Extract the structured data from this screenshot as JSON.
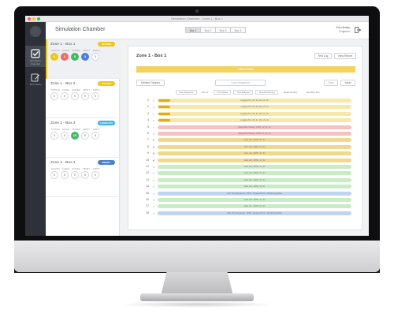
{
  "window": {
    "title": "Simulation Chamber - Zone 1 - Box 1",
    "traffic_colors": [
      "#ff5f57",
      "#febc2e",
      "#28c840"
    ]
  },
  "app": {
    "title": "Simulation Chamber"
  },
  "sidebar": {
    "items": [
      {
        "label": "Simulation Chamber",
        "icon": "checkbox-icon",
        "active": true
      },
      {
        "label": "Test Library",
        "icon": "edit-icon",
        "active": false
      }
    ]
  },
  "header": {
    "box_tabs": [
      {
        "label": "Box 1",
        "active": true
      },
      {
        "label": "Box 2",
        "active": false
      },
      {
        "label": "Box 3",
        "active": false
      },
      {
        "label": "Box 4",
        "active": false
      }
    ],
    "user": {
      "name": "Eric Henley",
      "role": "Engineer"
    }
  },
  "stat_labels": [
    "TESTING",
    "FAILED",
    "PASSED",
    "ABORT",
    "EMPTY"
  ],
  "zones": [
    {
      "name": "Zone 1 - Box 1",
      "status": "TESTING",
      "status_color": "#f0c419",
      "active": true,
      "stats": [
        {
          "value": "3",
          "color": "#f0c419"
        },
        {
          "value": "2",
          "color": "#ec6b6b"
        },
        {
          "value": "5",
          "color": "#45b865"
        },
        {
          "value": "3",
          "color": "#4a7fd4"
        },
        {
          "value": "0",
          "color": ""
        }
      ]
    },
    {
      "name": "Zone 1 - Box 2",
      "status": "TESTING",
      "status_color": "#f0c419",
      "active": false,
      "stats": [
        {
          "value": "0",
          "color": ""
        },
        {
          "value": "0",
          "color": ""
        },
        {
          "value": "0",
          "color": ""
        },
        {
          "value": "0",
          "color": ""
        },
        {
          "value": "0",
          "color": ""
        }
      ]
    },
    {
      "name": "Zone 2 - Box 3",
      "status": "COMPLETE",
      "status_color": "#3fb3e8",
      "active": false,
      "stats": [
        {
          "value": "0",
          "color": ""
        },
        {
          "value": "0",
          "color": ""
        },
        {
          "value": "10",
          "color": "#45b865"
        },
        {
          "value": "0",
          "color": ""
        },
        {
          "value": "0",
          "color": ""
        }
      ]
    },
    {
      "name": "Zone 2 - Box 4",
      "status": "READY",
      "status_color": "#4a7fd4",
      "active": false,
      "stats": [
        {
          "value": "0",
          "color": ""
        },
        {
          "value": "0",
          "color": ""
        },
        {
          "value": "0",
          "color": ""
        },
        {
          "value": "0",
          "color": ""
        },
        {
          "value": "0",
          "color": ""
        }
      ]
    }
  ],
  "panel": {
    "title": "Zone 1 - Box 1",
    "buttons": {
      "test_log": "Test Log",
      "view_report": "View Report",
      "select": "Monitor Options",
      "load": "Load Sequence",
      "start": "Start",
      "abort": "Abort"
    },
    "status_banner": "TESTING",
    "filters": [
      "Test Sequence",
      "Run 4",
      "3 Complete",
      "Time Elapsed",
      "Time Remaining",
      "Serial Number",
      "Test Step Info"
    ],
    "rows": [
      {
        "num": "1",
        "check": "○",
        "text": "Logging Tcs, 25, 3v, 16v, 2v, 3c",
        "color": "#f7e7a8",
        "progress": 0.06
      },
      {
        "num": "2",
        "check": "○",
        "text": "Logging Tcs, 25, 3v, 16v, 2v, 3c",
        "color": "#f7e7a8",
        "progress": 0.06
      },
      {
        "num": "3",
        "check": "○",
        "text": "Logging Tcs, 25, 3v, 16v, 2v, 3c",
        "color": "#f7e7a8",
        "progress": 0.06
      },
      {
        "num": "4",
        "check": "○",
        "text": "Logging Tcs, 25, 3v, 16v, 2v, 3c",
        "color": "#f7e7a8",
        "progress": 0.06
      },
      {
        "num": "5",
        "check": "○",
        "text": "Magnitude Sweep, 100%, 1c, 3c, 3c",
        "color": "#f6c1c1",
        "progress": 0
      },
      {
        "num": "6",
        "check": "○",
        "text": "Magnitude Sweep, 100%, 1c, 3c, 3c",
        "color": "#f6c1c1",
        "progress": 0
      },
      {
        "num": "7",
        "check": "✔",
        "text": "Gain List, 100%, 3c, 3c",
        "color": "#f0d98e",
        "progress": 0
      },
      {
        "num": "8",
        "check": "✔",
        "text": "Gain List, 100%, 3c, 3c",
        "color": "#f0d98e",
        "progress": 0
      },
      {
        "num": "9",
        "check": "✔",
        "text": "Gain List, 100%, 3c, 3c",
        "color": "#f0d98e",
        "progress": 0
      },
      {
        "num": "10",
        "check": "✔",
        "text": "Gain List, 100%, 3c, 3c",
        "color": "#f0d98e",
        "progress": 0
      },
      {
        "num": "11",
        "check": "○",
        "text": "Gain List, 100%, 3c, 3c",
        "color": "#c8ecc4",
        "progress": 0
      },
      {
        "num": "12",
        "check": "○",
        "text": "Gain List, 100%, 3c, 3c",
        "color": "#c8ecc4",
        "progress": 0
      },
      {
        "num": "13",
        "check": "○",
        "text": "Gain List, 100%, 3c, 3c",
        "color": "#c8ecc4",
        "progress": 0
      },
      {
        "num": "14",
        "check": "○",
        "text": "Gain List, 100%, 3c, 3c",
        "color": "#c8ecc4",
        "progress": 0
      },
      {
        "num": "15",
        "check": "○",
        "text": "LNC Test Sequence, 100% - Repeat Point - Monitoring Mode",
        "color": "#bfd4f3",
        "progress": 0
      },
      {
        "num": "16",
        "check": "○",
        "text": "Gain List, 100%, 3c, 3c",
        "color": "#c8ecc4",
        "progress": 0
      },
      {
        "num": "17",
        "check": "○",
        "text": "Gain List, 100%, 3c, 3c",
        "color": "#c8ecc4",
        "progress": 0
      },
      {
        "num": "18",
        "check": "○",
        "text": "LNC Test Sequence, 100% - Repeat Point - Monitoring Mode",
        "color": "#bfd4f3",
        "progress": 0
      }
    ]
  }
}
